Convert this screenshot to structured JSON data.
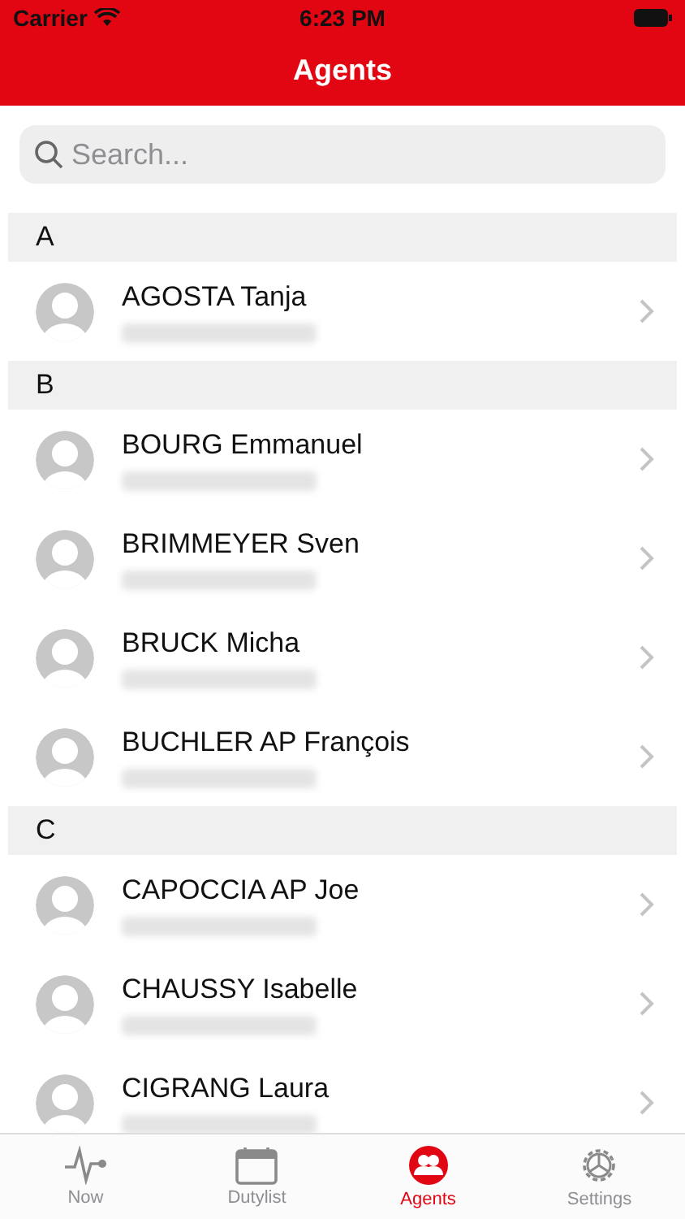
{
  "status_bar": {
    "carrier": "Carrier",
    "time": "6:23 PM"
  },
  "nav": {
    "title": "Agents"
  },
  "search": {
    "placeholder": "Search..."
  },
  "sections": [
    {
      "letter": "A",
      "agents": [
        {
          "name": "AGOSTA Tanja"
        }
      ]
    },
    {
      "letter": "B",
      "agents": [
        {
          "name": "BOURG Emmanuel"
        },
        {
          "name": "BRIMMEYER Sven"
        },
        {
          "name": "BRUCK Micha"
        },
        {
          "name": "BUCHLER AP François"
        }
      ]
    },
    {
      "letter": "C",
      "agents": [
        {
          "name": "CAPOCCIA AP Joe"
        },
        {
          "name": "CHAUSSY Isabelle"
        },
        {
          "name": "CIGRANG Laura"
        }
      ]
    }
  ],
  "tabs": [
    {
      "label": "Now",
      "kind": "pulse",
      "selected": false
    },
    {
      "label": "Dutylist",
      "kind": "calendar",
      "selected": false
    },
    {
      "label": "Agents",
      "kind": "people",
      "selected": true
    },
    {
      "label": "Settings",
      "kind": "gear",
      "selected": false
    }
  ]
}
